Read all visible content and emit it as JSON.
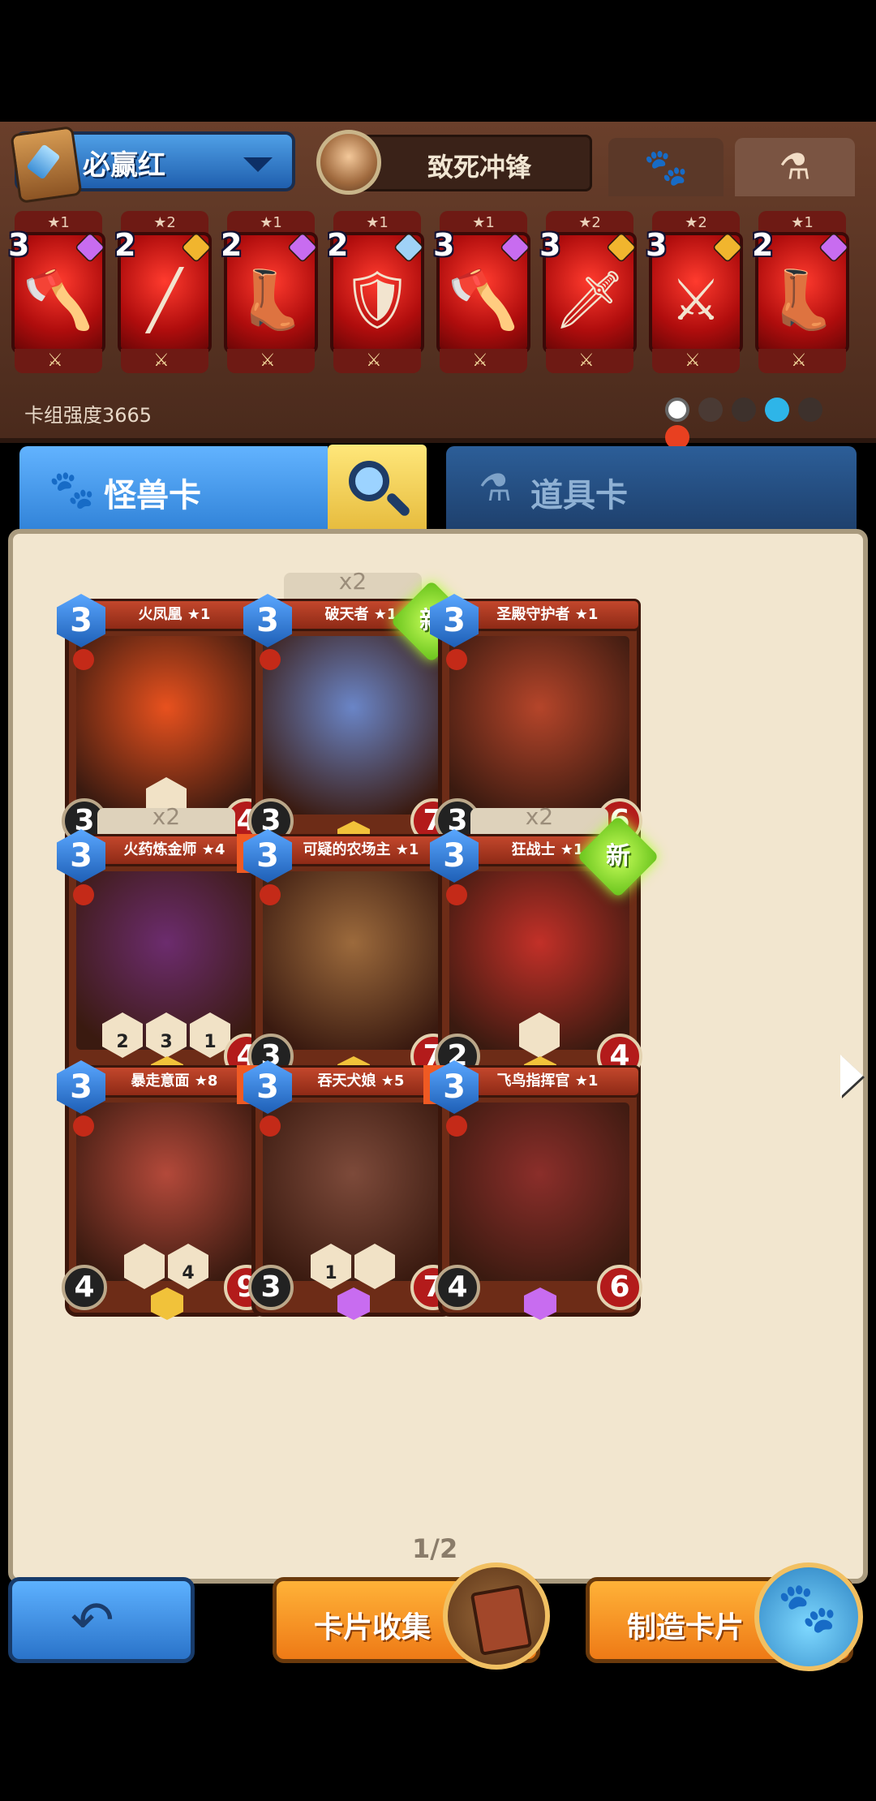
{
  "deck": {
    "name": "必赢红",
    "hero_name": "致死冲锋",
    "strength_label": "卡组强度3665",
    "tab_icons": [
      "paw-icon",
      "potion-icon"
    ],
    "cards": [
      {
        "stars": "★1",
        "cost": "3",
        "gem_color": "#c86cf0",
        "art": "axe-icon"
      },
      {
        "stars": "★2",
        "cost": "2",
        "gem_color": "#f1b52e",
        "art": "spear-icon"
      },
      {
        "stars": "★1",
        "cost": "2",
        "gem_color": "#c86cf0",
        "art": "boots-icon"
      },
      {
        "stars": "★1",
        "cost": "2",
        "gem_color": "#9fd2f7",
        "art": "gauntlet-icon"
      },
      {
        "stars": "★1",
        "cost": "3",
        "gem_color": "#c86cf0",
        "art": "axe-icon"
      },
      {
        "stars": "★2",
        "cost": "3",
        "gem_color": "#f1b52e",
        "art": "sword-icon"
      },
      {
        "stars": "★2",
        "cost": "3",
        "gem_color": "#f1b52e",
        "art": "halberd-icon"
      },
      {
        "stars": "★1",
        "cost": "2",
        "gem_color": "#c86cf0",
        "art": "boots-icon"
      }
    ]
  },
  "tabs": {
    "monster": "怪兽卡",
    "item": "道具卡"
  },
  "collection": {
    "page": "1/2",
    "cards": [
      {
        "title": "火凤凰 ★1",
        "cost": "3",
        "atk": "3",
        "hp": "4",
        "count": "",
        "flag": "",
        "new": false,
        "skills": [
          {
            "num": ""
          }
        ],
        "art_color": "#e8511e",
        "rarity": "#f1c23a"
      },
      {
        "title": "破天者 ★1",
        "cost": "3",
        "atk": "3",
        "hp": "7",
        "count": "x2",
        "flag": "",
        "new": true,
        "new_label": "新",
        "skills": [],
        "art_color": "#6a85c7",
        "rarity": "#f1c23a"
      },
      {
        "title": "圣殿守护者 ★1",
        "cost": "3",
        "atk": "3",
        "hp": "6",
        "count": "",
        "flag": "",
        "new": false,
        "skills": [],
        "art_color": "#b5452a",
        "rarity": "#f1c23a"
      },
      {
        "title": "火药炼金师 ★4",
        "cost": "3",
        "atk": "",
        "hp": "4",
        "count": "x2",
        "flag": "2",
        "new": false,
        "skills": [
          {
            "num": "2"
          },
          {
            "num": "3"
          },
          {
            "num": "1"
          }
        ],
        "art_color": "#6c2c6e",
        "rarity": "#f1c23a"
      },
      {
        "title": "可疑的农场主 ★1",
        "cost": "3",
        "atk": "3",
        "hp": "7",
        "count": "",
        "flag": "",
        "new": false,
        "skills": [],
        "art_color": "#9c6a3c",
        "rarity": "#f1c23a"
      },
      {
        "title": "狂战士 ★1",
        "cost": "3",
        "atk": "2",
        "hp": "4",
        "count": "x2",
        "flag": "",
        "new": true,
        "new_label": "新",
        "skills": [
          {
            "num": ""
          }
        ],
        "art_color": "#c23028",
        "rarity": "#f1c23a"
      },
      {
        "title": "暴走意面 ★8",
        "cost": "3",
        "atk": "4",
        "hp": "9",
        "count": "",
        "flag": "1",
        "new": false,
        "skills": [
          {
            "num": ""
          },
          {
            "num": "4"
          }
        ],
        "art_color": "#b3493a",
        "rarity": "#f1c23a"
      },
      {
        "title": "吞天犬娘 ★5",
        "cost": "3",
        "atk": "3",
        "hp": "7",
        "count": "",
        "flag": "1",
        "new": false,
        "skills": [
          {
            "num": "1"
          },
          {
            "num": ""
          }
        ],
        "art_color": "#7d4a3a",
        "rarity": "#c86cf0"
      },
      {
        "title": "飞鸟指挥官 ★1",
        "cost": "3",
        "atk": "4",
        "hp": "6",
        "count": "",
        "flag": "",
        "new": false,
        "skills": [],
        "art_color": "#8b2e2a",
        "rarity": "#c86cf0"
      }
    ]
  },
  "bottom": {
    "collect_label": "卡片收集",
    "craft_label": "制造卡片"
  }
}
